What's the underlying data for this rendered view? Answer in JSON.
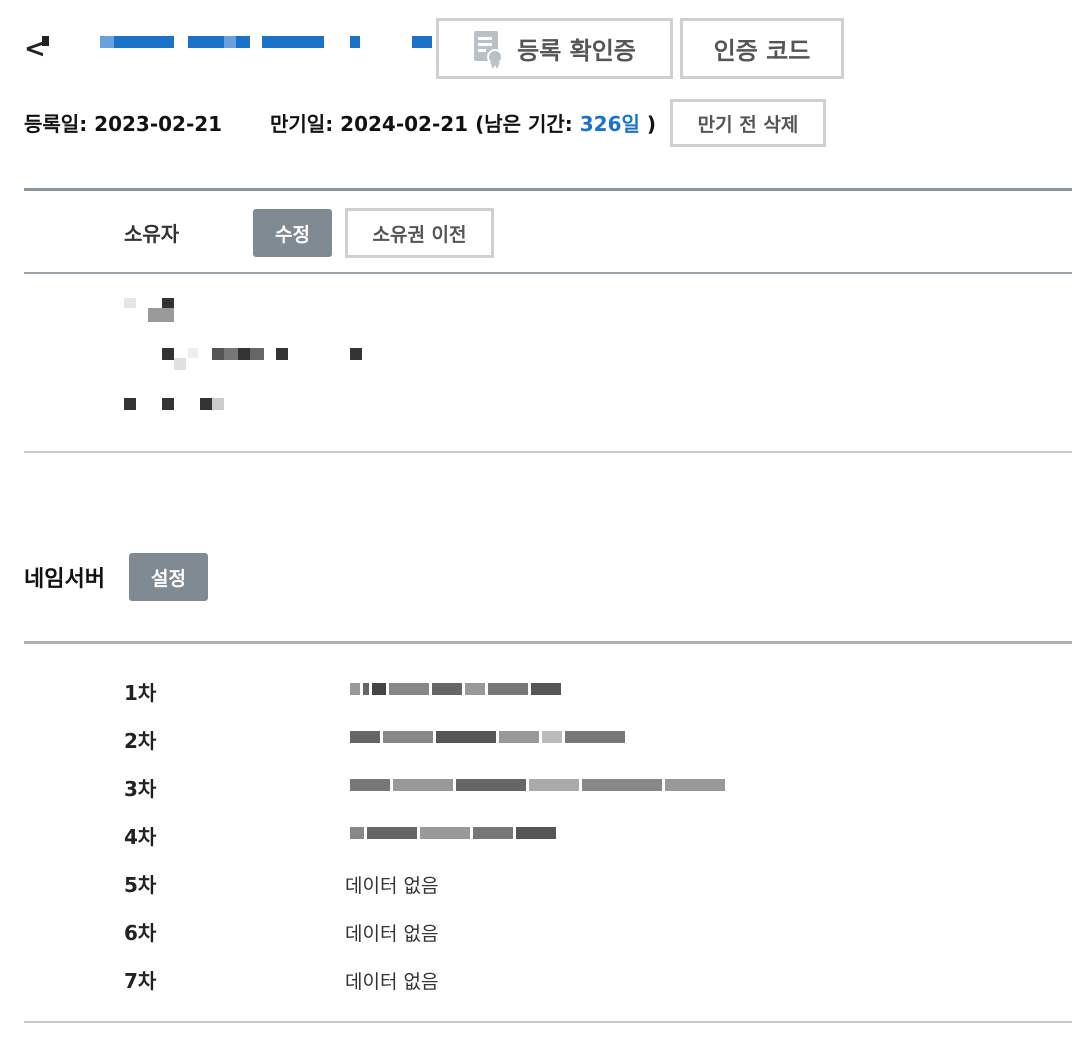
{
  "header": {
    "back_label": "<",
    "cert_button_label": "등록 확인증",
    "auth_code_button_label": "인증 코드",
    "cert_icon": "certificate-icon"
  },
  "dates": {
    "registered_label": "등록일:",
    "registered_value": "2023-02-21",
    "expiry_label": "만기일:",
    "expiry_value": "2024-02-21",
    "remaining_prefix": "(남은 기간:",
    "remaining_value": "326일",
    "remaining_suffix": ")",
    "delete_button_label": "만기 전 삭제"
  },
  "owner": {
    "section_label": "소유자",
    "edit_button_label": "수정",
    "transfer_button_label": "소유권 이전"
  },
  "nameserver": {
    "title": "네임서버",
    "settings_button_label": "설정",
    "rows": [
      {
        "label": "1차",
        "value": ""
      },
      {
        "label": "2차",
        "value": ""
      },
      {
        "label": "3차",
        "value": ""
      },
      {
        "label": "4차",
        "value": ""
      },
      {
        "label": "5차",
        "value": "데이터 없음"
      },
      {
        "label": "6차",
        "value": "데이터 없음"
      },
      {
        "label": "7차",
        "value": "데이터 없음"
      }
    ]
  },
  "colors": {
    "accent_blue": "#1a73c8",
    "button_gray": "#7f8a93",
    "border_gray": "#d0d0d0",
    "divider_dark": "#8a96a0"
  }
}
